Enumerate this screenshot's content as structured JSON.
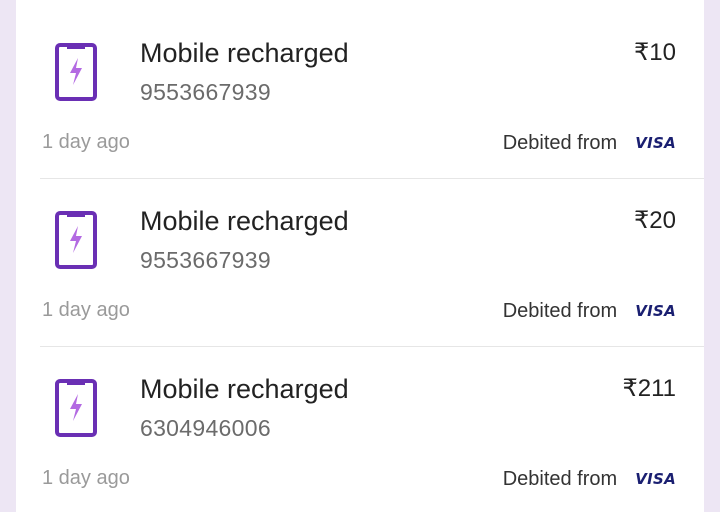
{
  "transactions": [
    {
      "title": "Mobile recharged",
      "number": "9553667939",
      "amount": "₹10",
      "time": "1 day ago",
      "debit_label": "Debited from",
      "payment_logo": "VISA"
    },
    {
      "title": "Mobile recharged",
      "number": "9553667939",
      "amount": "₹20",
      "time": "1 day ago",
      "debit_label": "Debited from",
      "payment_logo": "VISA"
    },
    {
      "title": "Mobile recharged",
      "number": "6304946006",
      "amount": "₹211",
      "time": "1 day ago",
      "debit_label": "Debited from",
      "payment_logo": "VISA"
    }
  ],
  "icons": {
    "transaction": "mobile-recharge-icon"
  },
  "colors": {
    "icon_frame": "#6a2fb4",
    "icon_bolt": "#b36ae2",
    "visa": "#1a1f71",
    "page_background": "#ede6f4"
  }
}
